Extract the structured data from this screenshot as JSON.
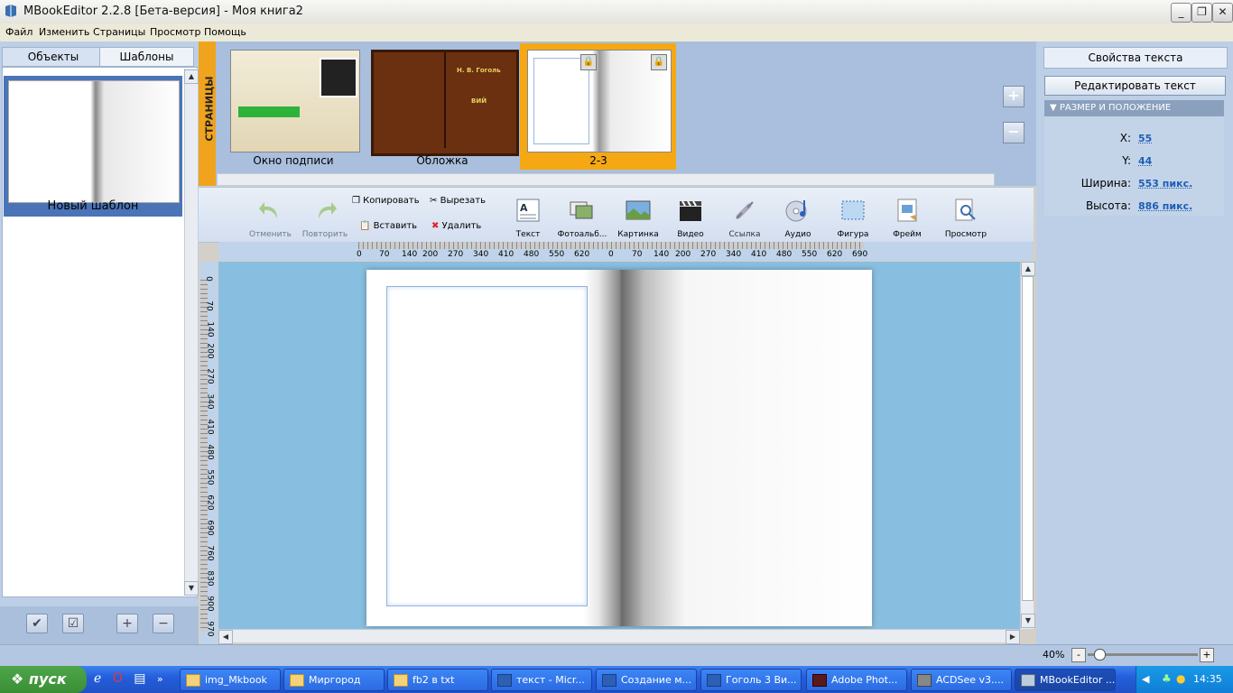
{
  "window": {
    "title": "MBookEditor 2.2.8 [Бета-версия] - Моя книга2",
    "buttons": {
      "minimize": "_",
      "maximize": "❐",
      "close": "✕"
    }
  },
  "menu": [
    "Файл",
    "Изменить",
    "Страницы",
    "Просмотр",
    "Помощь"
  ],
  "left": {
    "tabs": [
      "Объекты",
      "Шаблоны"
    ],
    "template": {
      "label": "Новый шаблон"
    }
  },
  "pages": {
    "vertical_label": "СТРАНИЦЫ",
    "items": [
      {
        "label": "Окно подписи"
      },
      {
        "label": "Обложка",
        "cover_author": "Н. В. Гоголь",
        "cover_title": "ВИЙ"
      },
      {
        "label": "2-3"
      }
    ]
  },
  "toolbar": {
    "undo": "Отменить",
    "redo": "Повторить",
    "copy": "Копировать",
    "cut": "Вырезать",
    "paste": "Вставить",
    "delete": "Удалить",
    "tools": [
      "Текст",
      "Фотоальб...",
      "Картинка",
      "Видео",
      "Ссылка",
      "Аудио",
      "Фигура",
      "Фрейм",
      "Просмотр"
    ]
  },
  "ruler": {
    "h": [
      "0",
      "70",
      "140",
      "200",
      "270",
      "340",
      "410",
      "480",
      "550",
      "620",
      "0",
      "70",
      "140",
      "200",
      "270",
      "340",
      "410",
      "480",
      "550",
      "620",
      "690"
    ],
    "v": [
      "0",
      "70",
      "140",
      "200",
      "270",
      "340",
      "410",
      "480",
      "550",
      "620",
      "690",
      "760",
      "830",
      "900",
      "970"
    ]
  },
  "right": {
    "tab": "Свойства текста",
    "edit_button": "Редактировать текст",
    "section": "РАЗМЕР И ПОЛОЖЕНИЕ",
    "props": [
      {
        "label": "X:",
        "value": "55"
      },
      {
        "label": "Y:",
        "value": "44"
      },
      {
        "label": "Ширина:",
        "value": "553 пикс."
      },
      {
        "label": "Высота:",
        "value": "886 пикс."
      }
    ]
  },
  "status": {
    "zoom": "40%"
  },
  "taskbar": {
    "start": "пуск",
    "tasks": [
      "img_Mkbook",
      "Миргород",
      "fb2 в txt",
      "текст - Micr...",
      "Создание м...",
      "Гоголь 3 Ви...",
      "Adobe Phot...",
      "ACDSee v3....",
      "MBookEditor ..."
    ],
    "clock": "14:35"
  }
}
